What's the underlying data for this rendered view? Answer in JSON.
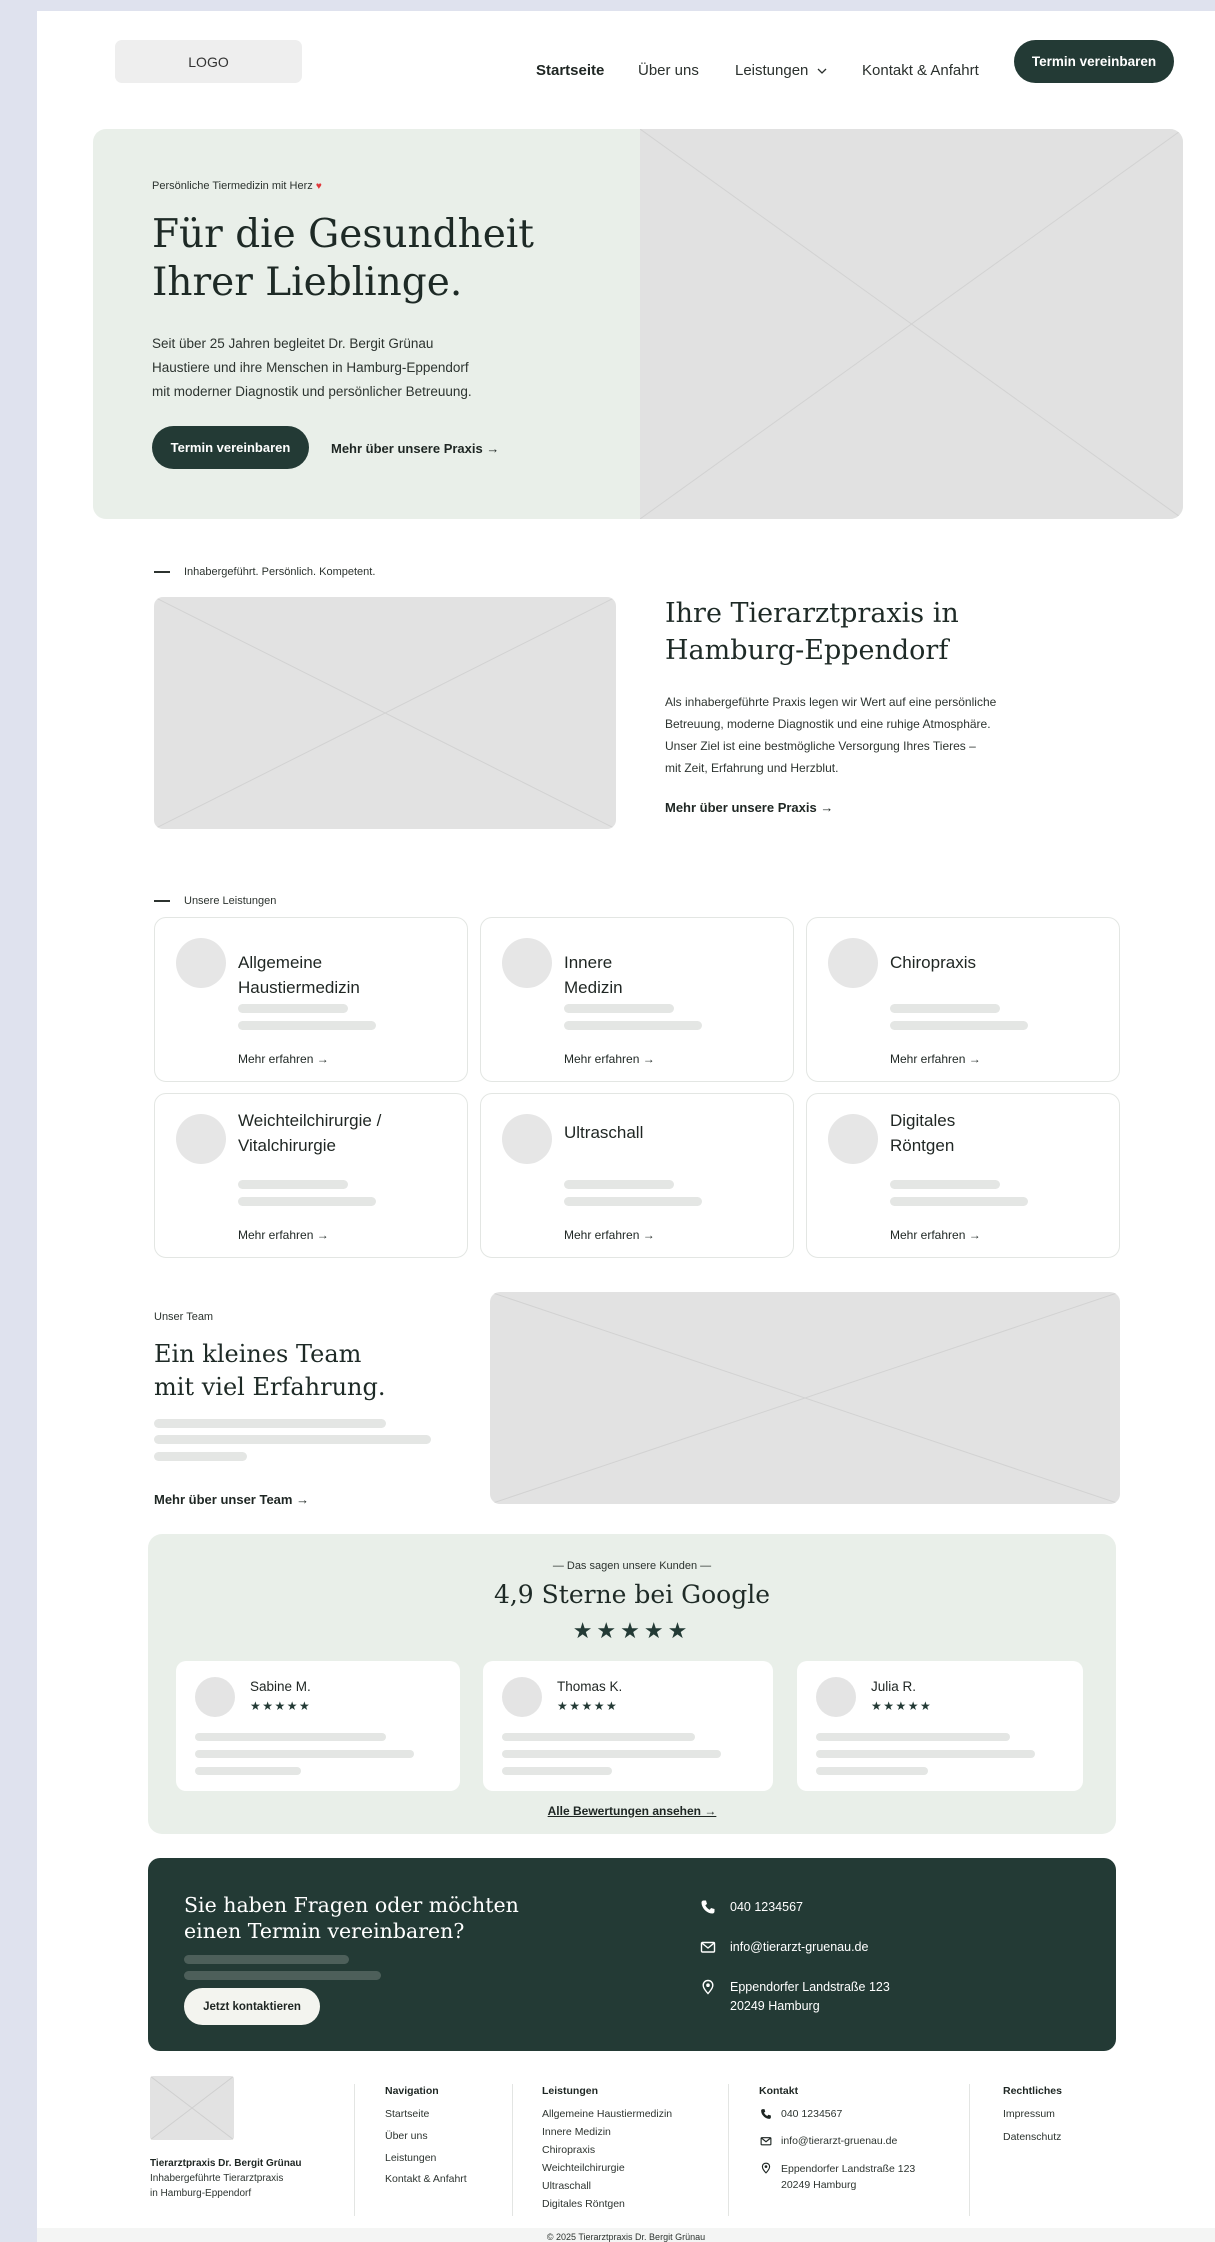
{
  "nav": {
    "logo": "LOGO",
    "links": [
      "Startseite",
      "Über uns",
      "Leistungen",
      "Kontakt & Anfahrt"
    ],
    "cta": "Termin vereinbaren"
  },
  "hero": {
    "eyebrow": "Persönliche Tiermedizin mit Herz",
    "title_line1": "Für die Gesundheit",
    "title_line2": "Ihrer Lieblinge.",
    "text_line1": "Seit über 25 Jahren begleitet Dr. Bergit Grünau",
    "text_line2": "Haustiere und ihre Menschen in Hamburg-Eppendorf",
    "text_line3": "mit moderner Diagnostik und persönlicher Betreuung.",
    "cta_primary": "Termin vereinbaren",
    "cta_secondary": "Mehr über unsere Praxis  →"
  },
  "about": {
    "label": "Inhabergeführt. Persönlich. Kompetent.",
    "title_line1": "Ihre Tierarztpraxis in",
    "title_line2": "Hamburg-Eppendorf",
    "text_line1": "Als inhabergeführte Praxis legen wir Wert auf eine persönliche",
    "text_line2": "Betreuung, moderne Diagnostik und eine ruhige Atmosphäre.",
    "text_line3": "Unser Ziel ist eine bestmögliche Versorgung Ihres Tieres –",
    "text_line4": "mit Zeit, Erfahrung und Herzblut.",
    "link": "Mehr über unsere Praxis  →"
  },
  "services": {
    "label": "Unsere Leistungen",
    "more": "Mehr erfahren  →",
    "items": [
      {
        "line1": "Allgemeine",
        "line2": "Haustiermedizin"
      },
      {
        "line1": "Innere",
        "line2": "Medizin"
      },
      {
        "line1": "Chiropraxis",
        "line2": ""
      },
      {
        "line1": "Weichteilchirurgie /",
        "line2": "Vitalchirurgie"
      },
      {
        "line1": "Ultraschall",
        "line2": ""
      },
      {
        "line1": "Digitales",
        "line2": "Röntgen"
      }
    ]
  },
  "team": {
    "label": "Unser Team",
    "title_line1": "Ein kleines Team",
    "title_line2": "mit viel Erfahrung.",
    "link": "Mehr über unser Team  →"
  },
  "reviews": {
    "label": "—  Das sagen unsere Kunden  —",
    "title": "4,9 Sterne bei Google",
    "stars": "★★★★★",
    "rating": 4.9,
    "items": [
      {
        "name": "Sabine M.",
        "stars": "★★★★★"
      },
      {
        "name": "Thomas K.",
        "stars": "★★★★★"
      },
      {
        "name": "Julia R.",
        "stars": "★★★★★"
      }
    ],
    "link": "Alle Bewertungen ansehen  →"
  },
  "contact": {
    "question_line1": "Sie haben Fragen oder möchten",
    "question_line2": "einen Termin vereinbaren?",
    "cta": "Jetzt kontaktieren",
    "phone": "040 1234567",
    "email": "info@tierarzt-gruenau.de",
    "address_line1": "Eppendorfer Landstraße 123",
    "address_line2": "20249 Hamburg"
  },
  "footer": {
    "brand_name": "Tierarztpraxis Dr. Bergit Grünau",
    "brand_line2": "Inhabergeführte Tierarztpraxis",
    "brand_line3": "in Hamburg-Eppendorf",
    "nav_title": "Navigation",
    "nav_items": [
      "Startseite",
      "Über uns",
      "Leistungen",
      "Kontakt & Anfahrt"
    ],
    "services_title": "Leistungen",
    "services_items": [
      "Allgemeine Haustiermedizin",
      "Innere Medizin",
      "Chiropraxis",
      "Weichteilchirurgie",
      "Ultraschall",
      "Digitales Röntgen"
    ],
    "contact_title": "Kontakt",
    "phone": "040 1234567",
    "email": "info@tierarzt-gruenau.de",
    "address_line1": "Eppendorfer Landstraße 123",
    "address_line2": "20249 Hamburg",
    "legal_title": "Rechtliches",
    "legal_items": [
      "Impressum",
      "Datenschutz"
    ],
    "copyright": "© 2025 Tierarztpraxis Dr. Bergit Grünau"
  },
  "colors": {
    "brand_dark": "#233a35",
    "section_bg": "#e9efe9",
    "heart": "#e0383b",
    "placeholder": "#e2e2e2"
  }
}
